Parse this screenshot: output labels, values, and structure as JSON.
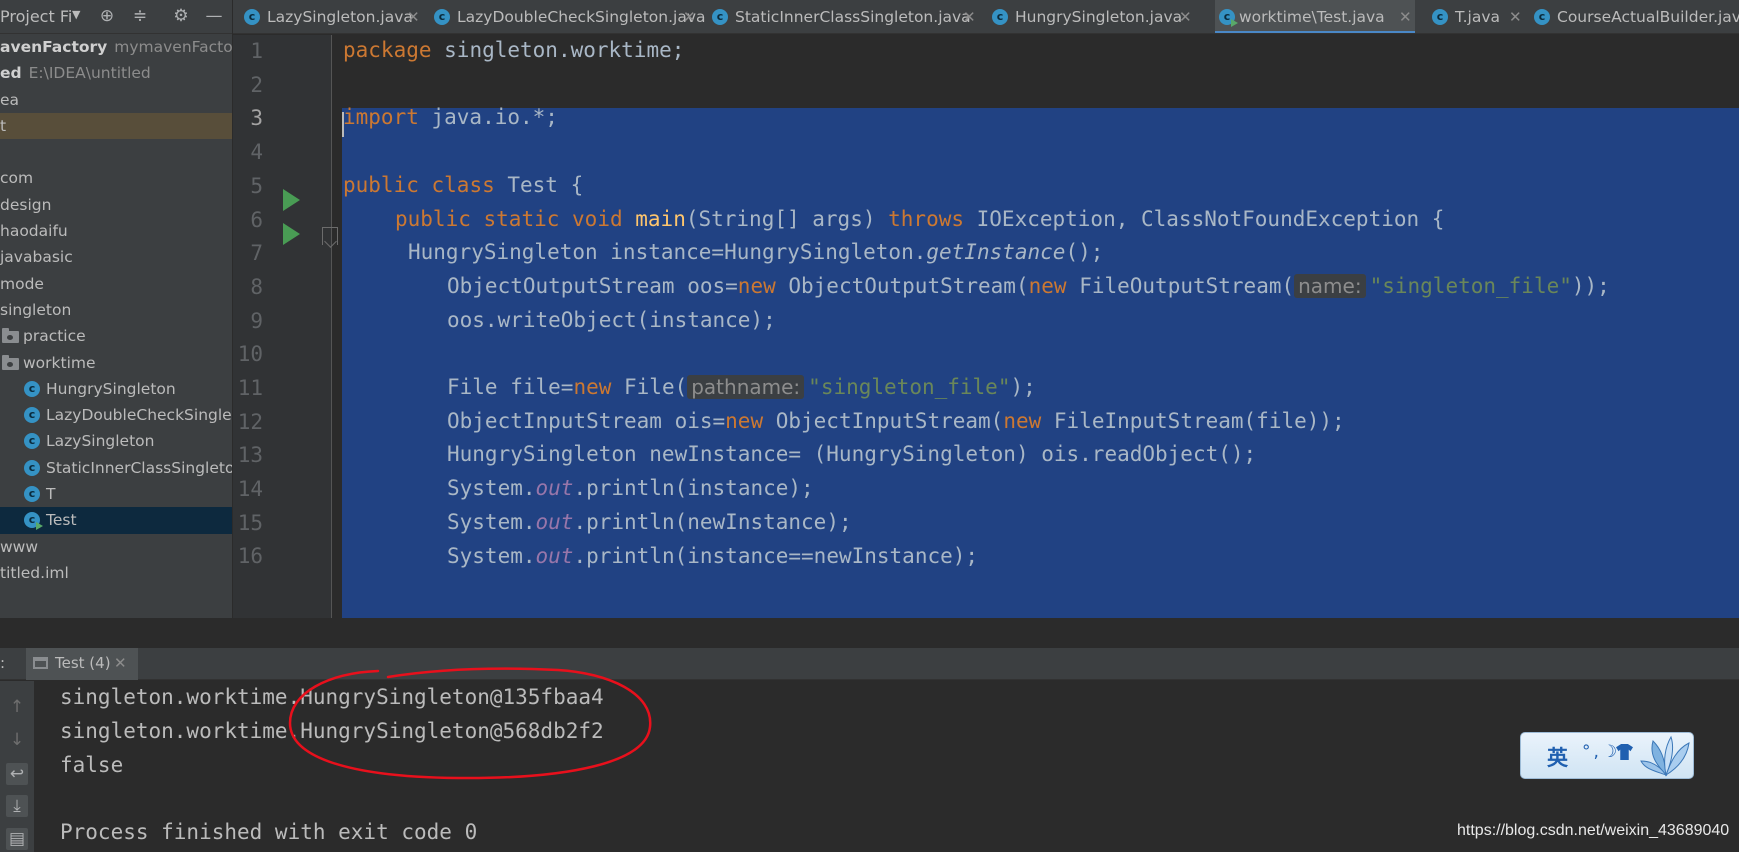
{
  "project_panel": {
    "title": "Project Fi",
    "tree": [
      {
        "label": "avenFactory",
        "secondary": "mymavenFactory"
      },
      {
        "label": "ed",
        "secondary": "E:\\IDEA\\untitled"
      },
      {
        "label": "ea",
        "secondary": ""
      },
      {
        "label": "t",
        "secondary": ""
      },
      {
        "label": "",
        "secondary": ""
      },
      {
        "label": "com",
        "secondary": ""
      },
      {
        "label": "design",
        "secondary": ""
      },
      {
        "label": "haodaifu",
        "secondary": ""
      },
      {
        "label": "javabasic",
        "secondary": ""
      },
      {
        "label": "mode",
        "secondary": ""
      },
      {
        "label": "singleton",
        "secondary": ""
      },
      {
        "label": "practice",
        "secondary": ""
      },
      {
        "label": "worktime",
        "secondary": ""
      },
      {
        "label": "HungrySingleton",
        "secondary": ""
      },
      {
        "label": "LazyDoubleCheckSingleto",
        "secondary": ""
      },
      {
        "label": "LazySingleton",
        "secondary": ""
      },
      {
        "label": "StaticInnerClassSingleton",
        "secondary": ""
      },
      {
        "label": "T",
        "secondary": ""
      },
      {
        "label": "Test",
        "secondary": ""
      },
      {
        "label": "www",
        "secondary": ""
      },
      {
        "label": "titled.iml",
        "secondary": ""
      }
    ]
  },
  "tabs": [
    {
      "label": "LazySingleton.java",
      "active": false
    },
    {
      "label": "LazyDoubleCheckSingleton.java",
      "active": false
    },
    {
      "label": "StaticInnerClassSingleton.java",
      "active": false
    },
    {
      "label": "HungrySingleton.java",
      "active": false
    },
    {
      "label": "worktime\\Test.java",
      "active": true
    },
    {
      "label": "T.java",
      "active": false
    },
    {
      "label": "CourseActualBuilder.java",
      "active": false
    }
  ],
  "editor": {
    "line_numbers": [
      "1",
      "2",
      "3",
      "4",
      "5",
      "6",
      "7",
      "8",
      "9",
      "10",
      "11",
      "12",
      "13",
      "14",
      "15",
      "16"
    ],
    "current_line": 3,
    "lines": [
      {
        "no": 1,
        "text": "package singleton.worktime;"
      },
      {
        "no": 2,
        "text": ""
      },
      {
        "no": 3,
        "text": "import java.io.*;"
      },
      {
        "no": 4,
        "text": ""
      },
      {
        "no": 5,
        "text": "public class Test {"
      },
      {
        "no": 6,
        "text": "    public static void main(String[] args) throws IOException, ClassNotFoundException {"
      },
      {
        "no": 7,
        "text": "     HungrySingleton instance=HungrySingleton.getInstance();"
      },
      {
        "no": 8,
        "text": "        ObjectOutputStream oos=new ObjectOutputStream(new FileOutputStream( name: \"singleton_file\"));"
      },
      {
        "no": 9,
        "text": "        oos.writeObject(instance);"
      },
      {
        "no": 10,
        "text": ""
      },
      {
        "no": 11,
        "text": "        File file=new File( pathname: \"singleton_file\");"
      },
      {
        "no": 12,
        "text": "        ObjectInputStream ois=new ObjectInputStream(new FileInputStream(file));"
      },
      {
        "no": 13,
        "text": "        HungrySingleton newInstance= (HungrySingleton) ois.readObject();"
      },
      {
        "no": 14,
        "text": "        System.out.println(instance);"
      },
      {
        "no": 15,
        "text": "        System.out.println(newInstance);"
      },
      {
        "no": 16,
        "text": "        System.out.println(instance==newInstance);"
      }
    ],
    "tokens": {
      "package": "package",
      "package_name": " singleton.worktime;",
      "import": "import",
      "import_path": " java.io.*;",
      "public": "public",
      "class": "class",
      "static": "static",
      "void": "void",
      "test_class": " Test {",
      "main": "main",
      "main_params": "(String[] args) ",
      "throws": "throws",
      "exceptions": " IOException, ClassNotFoundException {",
      "l7_a": "HungrySingleton instance=HungrySingleton.",
      "l7_m": "getInstance",
      "l7_b": "();",
      "l8_a": "ObjectOutputStream oos=",
      "new": "new",
      "l8_b": " ObjectOutputStream(",
      "l8_c": " FileOutputStream(",
      "hint_name": "name:",
      "str_file": "\"singleton_file\"",
      "l8_end": "));",
      "l9": "oos.writeObject(instance);",
      "l11_a": "File file=",
      "l11_b": " File(",
      "hint_pathname": "pathname:",
      "l11_end": ");",
      "l12_a": "ObjectInputStream ois=",
      "l12_b": " ObjectInputStream(",
      "l12_c": " FileInputStream(file));",
      "l13": "HungrySingleton newInstance= (HungrySingleton) ois.readObject();",
      "system": "System.",
      "out": "out",
      "l14_b": ".println(instance);",
      "l15_b": ".println(newInstance);",
      "l16_b": ".println(instance==newInstance);"
    }
  },
  "run_panel": {
    "prefix": ":",
    "tab_label": "Test (4)",
    "output": [
      "singleton.worktime.HungrySingleton@135fbaa4",
      "singleton.worktime.HungrySingleton@568db2f2",
      "false",
      "",
      "Process finished with exit code 0"
    ]
  },
  "ime": {
    "lang": "英",
    "punct": "°,☽"
  },
  "watermark": "https://blog.csdn.net/weixin_43689040",
  "colors": {
    "keyword": "#cc7832",
    "string": "#6a8759",
    "method": "#ffc66d",
    "static_field": "#9876aa",
    "selection": "#214283",
    "annotation": "#e8101c"
  }
}
